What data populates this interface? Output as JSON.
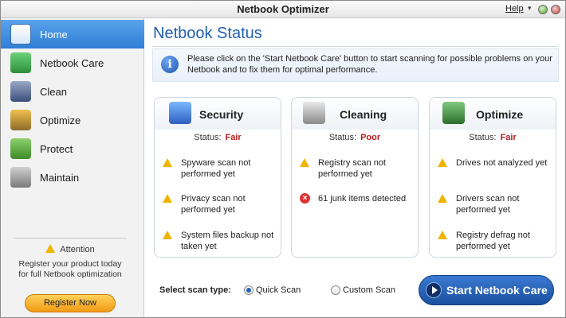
{
  "app": {
    "title": "Netbook Optimizer",
    "help_label": "Help",
    "help_arrow": "▾"
  },
  "sidebar": {
    "items": [
      {
        "label": "Home",
        "icon": "home-icon"
      },
      {
        "label": "Netbook Care",
        "icon": "netbook-care-icon"
      },
      {
        "label": "Clean",
        "icon": "clean-icon"
      },
      {
        "label": "Optimize",
        "icon": "optimize-icon"
      },
      {
        "label": "Protect",
        "icon": "protect-icon"
      },
      {
        "label": "Maintain",
        "icon": "maintain-icon"
      }
    ],
    "active_index": 0,
    "attention": {
      "title": "Attention",
      "text": "Register your product today for full Netbook optimization",
      "button": "Register Now"
    }
  },
  "main": {
    "title": "Netbook Status",
    "info": "Please click on the 'Start Netbook Care' button to start scanning for possible problems on your Netbook and to fix them for optimal performance.",
    "cards": [
      {
        "title": "Security",
        "status_label": "Status:",
        "status_value": "Fair",
        "issues": [
          {
            "type": "warning",
            "text": "Spyware scan not performed yet"
          },
          {
            "type": "warning",
            "text": "Privacy scan not performed yet"
          },
          {
            "type": "warning",
            "text": "System files backup not taken yet"
          }
        ]
      },
      {
        "title": "Cleaning",
        "status_label": "Status:",
        "status_value": "Poor",
        "issues": [
          {
            "type": "warning",
            "text": "Registry scan not performed yet"
          },
          {
            "type": "error",
            "text": "61 junk items detected"
          }
        ]
      },
      {
        "title": "Optimize",
        "status_label": "Status:",
        "status_value": "Fair",
        "issues": [
          {
            "type": "warning",
            "text": "Drives not analyzed yet"
          },
          {
            "type": "warning",
            "text": "Drivers scan not performed yet"
          },
          {
            "type": "warning",
            "text": "Registry defrag not performed yet"
          }
        ]
      }
    ],
    "scan": {
      "label": "Select scan type:",
      "options": [
        "Quick Scan",
        "Custom Scan"
      ],
      "selected": "Quick Scan"
    },
    "start_button": "Start Netbook Care"
  },
  "colors": {
    "accent": "#2f7fd6",
    "title_blue": "#1f5fb0",
    "status_red": "#b81c1c",
    "warning": "#f0b400"
  }
}
